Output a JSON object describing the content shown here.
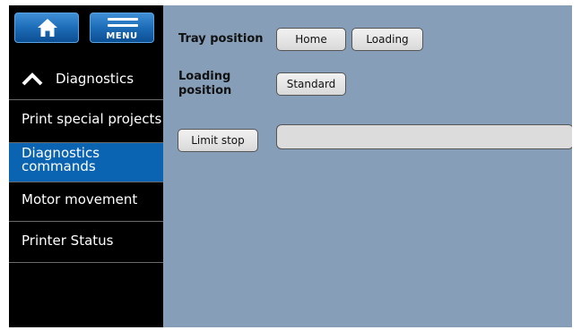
{
  "topbar": {
    "home_icon": "home-icon",
    "menu_label": "MENU",
    "menu_icon": "hamburger-icon"
  },
  "sidebar": {
    "header": {
      "label": "Diagnostics",
      "icon": "chevron-up-icon"
    },
    "items": [
      {
        "label": "Print special projects",
        "selected": false
      },
      {
        "label": "Diagnostics commands",
        "selected": true
      },
      {
        "label": "Motor movement",
        "selected": false
      },
      {
        "label": "Printer Status",
        "selected": false
      }
    ]
  },
  "main": {
    "tray_position": {
      "label": "Tray position",
      "home_button": "Home",
      "loading_button": "Loading"
    },
    "loading_position": {
      "label": "Loading position",
      "standard_button": "Standard"
    },
    "limit_stop": {
      "button": "Limit stop",
      "value": ""
    }
  },
  "colors": {
    "sidebar_bg": "#000000",
    "selected_item": "#0a64b2",
    "main_bg": "#869eb8",
    "top_button": "#1d6cb7"
  }
}
